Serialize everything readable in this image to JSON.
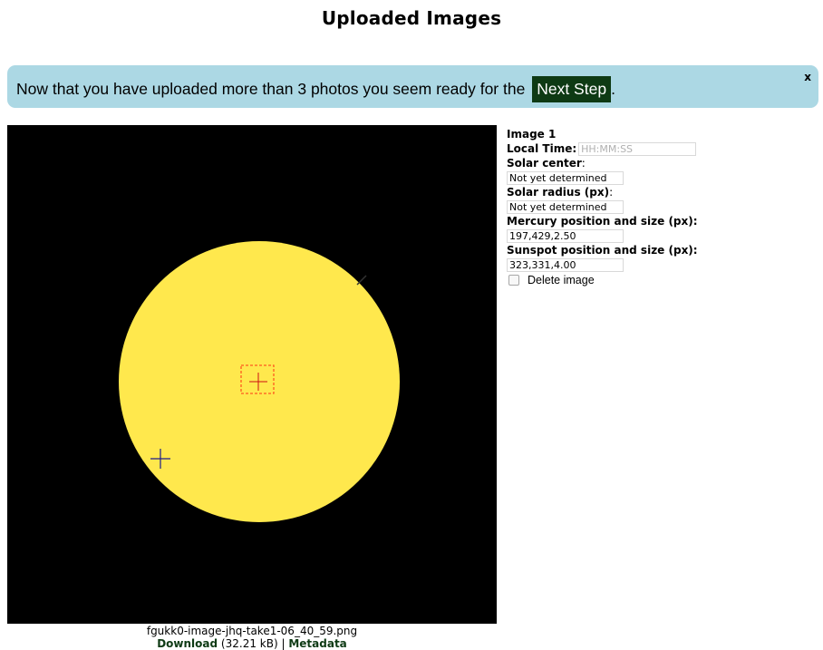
{
  "page": {
    "title": "Uploaded Images"
  },
  "banner": {
    "message": "Now that you have uploaded more than 3 photos you seem ready for the",
    "link_label": "Next Step",
    "suffix": ".",
    "close_label": "x",
    "background": "#acd8e4",
    "link_background": "#0e3a14"
  },
  "image": {
    "sun_color": "#ffe84d",
    "background": "#000000",
    "filename": "fgukk0-image-jhq-take1-06_40_59.png",
    "download_label": "Download",
    "size": "(32.21 kB)",
    "separator": "|",
    "metadata_label": "Metadata"
  },
  "meta": {
    "heading": "Image 1",
    "local_time_label": "Local Time:",
    "local_time_placeholder": "HH:MM:SS",
    "local_time_value": "",
    "solar_center_label": "Solar center",
    "solar_center_colon": ":",
    "solar_center_value": "Not yet determined",
    "solar_radius_label": "Solar radius (px)",
    "solar_radius_colon": ":",
    "solar_radius_value": "Not yet determined",
    "mercury_label": "Mercury position and size (px):",
    "mercury_value": "197,429,2.50",
    "sunspot_label": "Sunspot position and size (px):",
    "sunspot_value": "323,331,4.00",
    "delete_label": "Delete image",
    "delete_checked": false
  },
  "markers": {
    "mercury_marker_color": "#1c1c8a",
    "sunspot_marker_color": "#cc1111",
    "selection_box_color": "#ff5a1f"
  }
}
